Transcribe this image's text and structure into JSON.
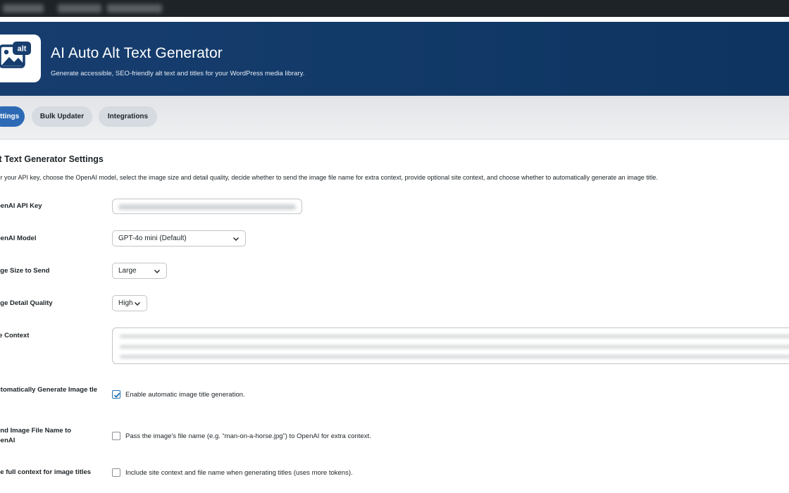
{
  "header": {
    "icon_label": "alt",
    "title": "AI Auto Alt Text Generator",
    "subtitle": "Generate accessible, SEO-friendly alt text and titles for your WordPress media library."
  },
  "tabs": [
    {
      "label": "ttings",
      "active": true
    },
    {
      "label": "Bulk Updater",
      "active": false
    },
    {
      "label": "Integrations",
      "active": false
    }
  ],
  "settings": {
    "section_title": "lt Text Generator Settings",
    "intro": "ter your API key, choose the OpenAI model, select the image size and detail quality, decide whether to send the image file name for extra context, provide optional site context, and choose whether to automatically generate an image title.",
    "api_key": {
      "label": "penAI API Key",
      "value": ""
    },
    "model": {
      "label": "penAI Model",
      "selected": "GPT-4o mini (Default)"
    },
    "image_size": {
      "label": "age Size to Send",
      "selected": "Large"
    },
    "detail_quality": {
      "label": "age Detail Quality",
      "selected": "High"
    },
    "site_context": {
      "label": "te Context",
      "value": ""
    },
    "auto_title": {
      "label": "utomatically Generate Image tle",
      "checkbox_text": "Enable automatic image title generation.",
      "checked": true
    },
    "send_filename": {
      "label": "end Image File Name to penAI",
      "checkbox_text": "Pass the image's file name (e.g. “man-on-a-horse.jpg”) to OpenAI for extra context.",
      "checked": false
    },
    "full_context": {
      "label": "se full context for image titles",
      "checkbox_text": "Include site context and file name when generating titles (uses more tokens).",
      "checked": false
    }
  },
  "colors": {
    "accent": "#2d6ab5",
    "header_bg": "#123a68",
    "admin_bar": "#1d2327"
  }
}
